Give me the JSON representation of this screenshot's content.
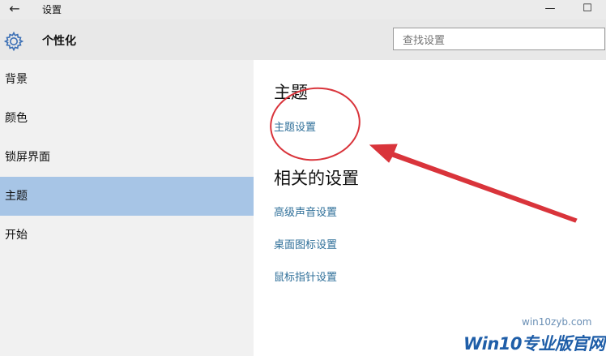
{
  "window": {
    "back_glyph": "←",
    "title": "设置",
    "minimize_glyph": "—",
    "maximize_glyph": "☐"
  },
  "header": {
    "page_title": "个性化",
    "search_placeholder": "查找设置",
    "icon": "gear-icon"
  },
  "sidebar": {
    "items": [
      {
        "label": "背景",
        "selected": false
      },
      {
        "label": "颜色",
        "selected": false
      },
      {
        "label": "锁屏界面",
        "selected": false
      },
      {
        "label": "主题",
        "selected": true
      },
      {
        "label": "开始",
        "selected": false
      }
    ]
  },
  "main": {
    "theme_heading": "主题",
    "theme_settings_link": "主题设置",
    "related_heading": "相关的设置",
    "related_links": [
      "高级声音设置",
      "桌面图标设置",
      "鼠标指针设置"
    ]
  },
  "watermark": {
    "brand": "Win10专业版官网",
    "url": "win10zyb.com"
  },
  "colors": {
    "selected_item": "#a7c5e6",
    "link": "#2f6f99",
    "annotation": "#d9343b"
  }
}
